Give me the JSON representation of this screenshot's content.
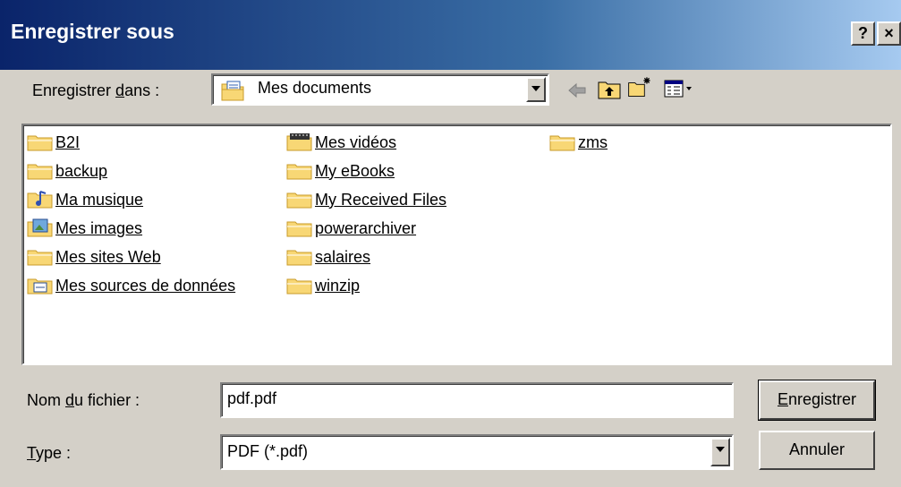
{
  "window": {
    "title": "Enregistrer sous",
    "help_glyph": "?",
    "close_glyph": "×"
  },
  "location": {
    "label_pre": "Enregistrer ",
    "label_u": "d",
    "label_post": "ans :",
    "value": "Mes documents",
    "icon": "my-documents-icon"
  },
  "toolbar": {
    "icons": [
      "back-arrow-icon",
      "up-folder-icon",
      "new-folder-icon",
      "view-menu-icon"
    ]
  },
  "files": [
    {
      "name": "B2I",
      "icon": "folder-icon"
    },
    {
      "name": "backup",
      "icon": "folder-icon"
    },
    {
      "name": "Ma musique",
      "icon": "music-folder-icon"
    },
    {
      "name": "Mes images",
      "icon": "pictures-folder-icon"
    },
    {
      "name": "Mes sites Web",
      "icon": "folder-icon"
    },
    {
      "name": "Mes sources de données",
      "icon": "data-sources-folder-icon"
    },
    {
      "name": "Mes vidéos",
      "icon": "video-folder-icon"
    },
    {
      "name": "My eBooks",
      "icon": "folder-icon"
    },
    {
      "name": "My Received Files",
      "icon": "folder-icon"
    },
    {
      "name": "powerarchiver",
      "icon": "folder-icon"
    },
    {
      "name": "salaires",
      "icon": "folder-icon"
    },
    {
      "name": "winzip",
      "icon": "folder-icon"
    },
    {
      "name": "zms",
      "icon": "folder-icon"
    }
  ],
  "filename": {
    "label_pre": "Nom ",
    "label_u": "d",
    "label_post": "u fichier :",
    "value": "pdf.pdf"
  },
  "filetype": {
    "label_u": "T",
    "label_post": "ype :",
    "value": "PDF (*.pdf)"
  },
  "buttons": {
    "save_u": "E",
    "save_rest": "nregistrer",
    "cancel": "Annuler"
  },
  "colors": {
    "folder": "#f8d775",
    "folder_dark": "#c89b2a",
    "title_start": "#0a246a",
    "title_end": "#a6caf0"
  }
}
